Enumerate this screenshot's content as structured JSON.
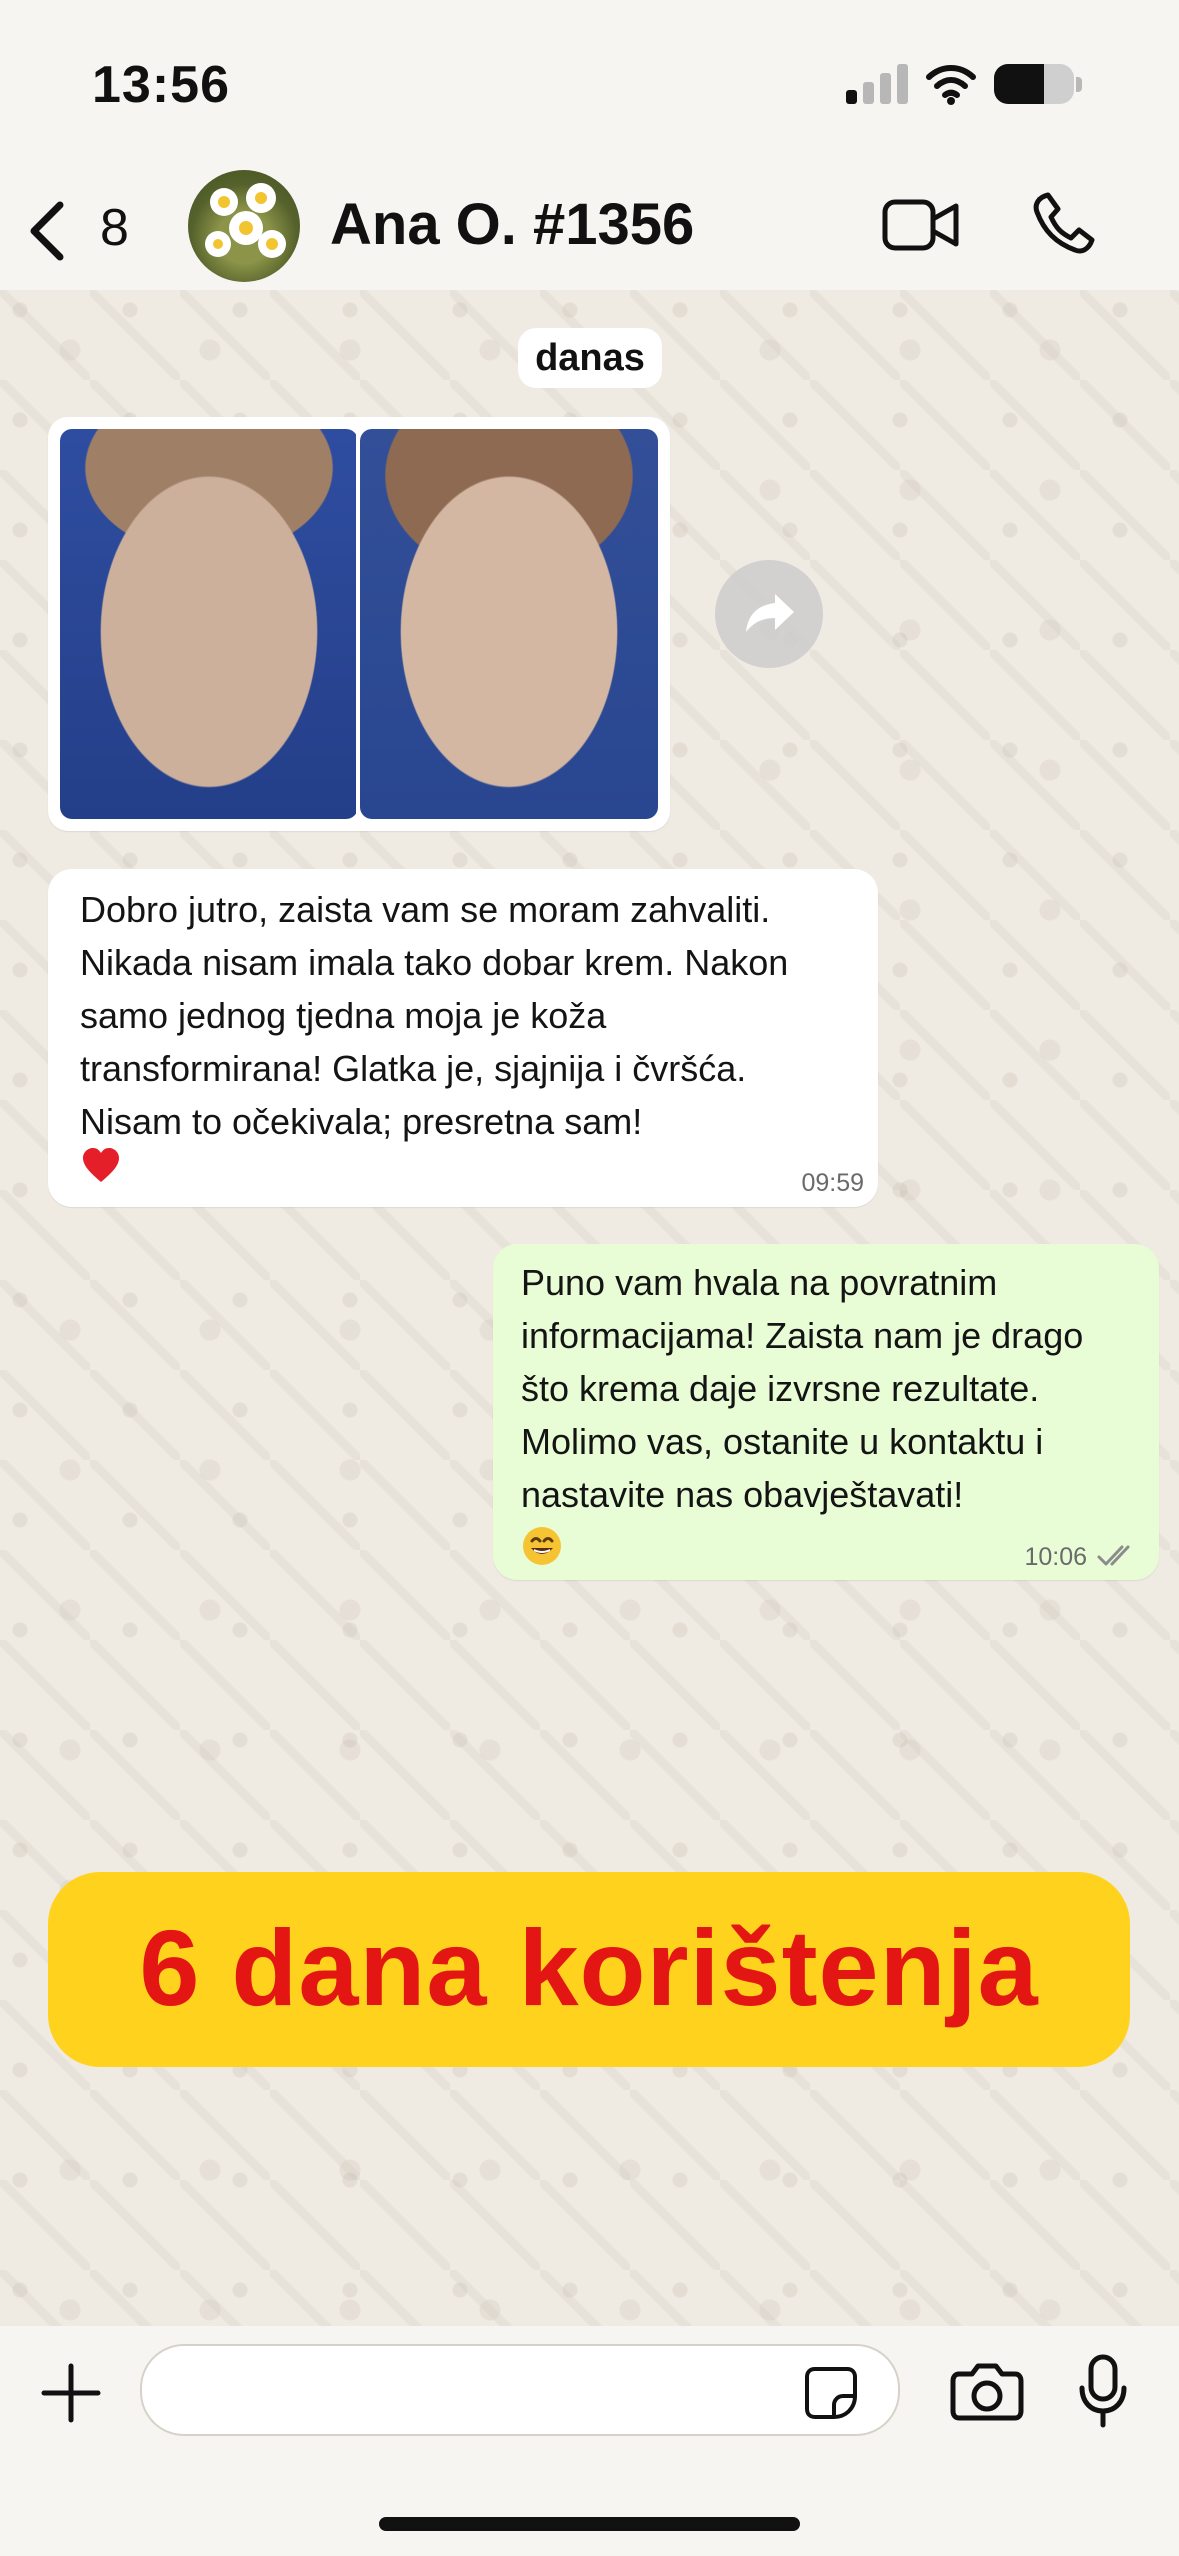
{
  "status_bar": {
    "time": "13:56"
  },
  "header": {
    "back_count": "8",
    "title": "Ana O. #1356"
  },
  "conversation": {
    "date_chip": "danas",
    "messages": [
      {
        "text": "Dobro jutro, zaista vam se moram zahvaliti. Nikada nisam imala tako dobar krem. Nakon samo jednog tjedna moja je koža transformirana! Glatka je, sjajnija i čvršća. Nisam to očekivala; presretna sam!",
        "emoji": "heart-icon",
        "time": "09:59"
      },
      {
        "text": "Puno vam hvala na povratnim informacijama! Zaista nam je drago što krema daje izvrsne rezultate. Molimo vas, ostanite u kontaktu i nastavite nas obavještavati!",
        "emoji": "grinning-face-icon",
        "time": "10:06"
      }
    ]
  },
  "banner": {
    "text": "6 dana korištenja"
  },
  "icons": {
    "back": "chevron-left-icon",
    "video": "video-call-icon",
    "phone": "phone-icon",
    "forward": "forward-icon",
    "plus": "plus-icon",
    "sticker": "sticker-icon",
    "camera": "camera-icon",
    "mic": "microphone-icon"
  },
  "colors": {
    "incoming_bubble": "#ffffff",
    "outgoing_bubble": "#e8fcd6",
    "banner_bg": "#ffd31d",
    "banner_text": "#e31613"
  }
}
